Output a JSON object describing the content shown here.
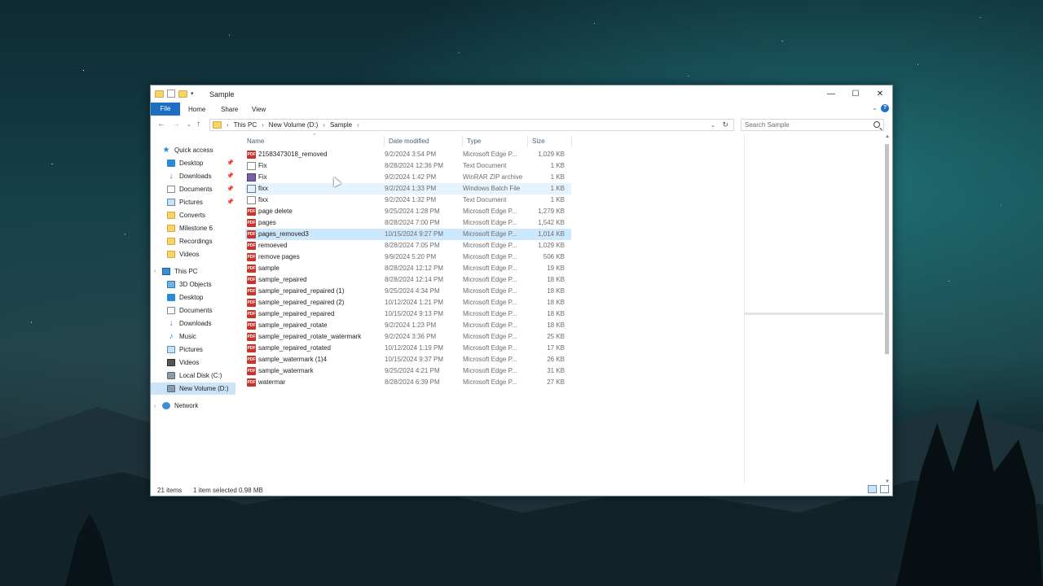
{
  "window": {
    "title": "Sample",
    "controls": {
      "minimize": "—",
      "maximize": "☐",
      "close": "✕"
    }
  },
  "ribbon": {
    "tabs": [
      {
        "label": "File",
        "active": true
      },
      {
        "label": "Home"
      },
      {
        "label": "Share"
      },
      {
        "label": "View"
      }
    ],
    "help_label": "?"
  },
  "address": {
    "breadcrumbs": [
      "This PC",
      "New Volume (D:)",
      "Sample"
    ],
    "search_placeholder": "Search Sample"
  },
  "sidebar": {
    "quick_access": {
      "label": "Quick access"
    },
    "quick_items": [
      {
        "label": "Desktop",
        "icon": "desktop-icon",
        "pinned": true
      },
      {
        "label": "Downloads",
        "icon": "download-icon",
        "pinned": true
      },
      {
        "label": "Documents",
        "icon": "documents-icon",
        "pinned": true
      },
      {
        "label": "Pictures",
        "icon": "pictures-icon",
        "pinned": true
      },
      {
        "label": "Converts",
        "icon": "folder-icon"
      },
      {
        "label": "Milestone 6",
        "icon": "folder-icon"
      },
      {
        "label": "Recordings",
        "icon": "folder-icon"
      },
      {
        "label": "Videos",
        "icon": "folder-icon"
      }
    ],
    "this_pc": {
      "label": "This PC"
    },
    "pc_items": [
      {
        "label": "3D Objects",
        "icon": "3d-objects-icon"
      },
      {
        "label": "Desktop",
        "icon": "desktop-icon"
      },
      {
        "label": "Documents",
        "icon": "documents-icon"
      },
      {
        "label": "Downloads",
        "icon": "download-icon"
      },
      {
        "label": "Music",
        "icon": "music-icon"
      },
      {
        "label": "Pictures",
        "icon": "pictures-icon"
      },
      {
        "label": "Videos",
        "icon": "videos-icon"
      },
      {
        "label": "Local Disk (C:)",
        "icon": "drive-icon"
      },
      {
        "label": "New Volume (D:)",
        "icon": "drive-icon",
        "selected": true
      }
    ],
    "network": {
      "label": "Network"
    }
  },
  "columns": {
    "name": "Name",
    "date": "Date modified",
    "type": "Type",
    "size": "Size"
  },
  "files": [
    {
      "name": "21583473018_removed",
      "date": "9/2/2024 3:54 PM",
      "type": "Microsoft Edge P...",
      "size": "1,029 KB",
      "icon": "pdf"
    },
    {
      "name": "Fix",
      "date": "8/28/2024 12:36 PM",
      "type": "Text Document",
      "size": "1 KB",
      "icon": "txt"
    },
    {
      "name": "Fix",
      "date": "9/2/2024 1:42 PM",
      "type": "WinRAR ZIP archive",
      "size": "1 KB",
      "icon": "zip"
    },
    {
      "name": "fixx",
      "date": "9/2/2024 1:33 PM",
      "type": "Windows Batch File",
      "size": "1 KB",
      "icon": "bat",
      "hover": true
    },
    {
      "name": "fixx",
      "date": "9/2/2024 1:32 PM",
      "type": "Text Document",
      "size": "1 KB",
      "icon": "txt"
    },
    {
      "name": "page delete",
      "date": "9/25/2024 1:28 PM",
      "type": "Microsoft Edge P...",
      "size": "1,279 KB",
      "icon": "pdf"
    },
    {
      "name": "pages",
      "date": "8/28/2024 7:00 PM",
      "type": "Microsoft Edge P...",
      "size": "1,542 KB",
      "icon": "pdf"
    },
    {
      "name": "pages_removed3",
      "date": "10/15/2024 9:27 PM",
      "type": "Microsoft Edge P...",
      "size": "1,014 KB",
      "icon": "pdf",
      "selected": true
    },
    {
      "name": "remoeved",
      "date": "8/28/2024 7:05 PM",
      "type": "Microsoft Edge P...",
      "size": "1,029 KB",
      "icon": "pdf"
    },
    {
      "name": "remove pages",
      "date": "9/9/2024 5:20 PM",
      "type": "Microsoft Edge P...",
      "size": "506 KB",
      "icon": "pdf"
    },
    {
      "name": "sample",
      "date": "8/28/2024 12:12 PM",
      "type": "Microsoft Edge P...",
      "size": "19 KB",
      "icon": "pdf"
    },
    {
      "name": "sample_repaired",
      "date": "8/28/2024 12:14 PM",
      "type": "Microsoft Edge P...",
      "size": "18 KB",
      "icon": "pdf"
    },
    {
      "name": "sample_repaired_repaired (1)",
      "date": "9/25/2024 4:34 PM",
      "type": "Microsoft Edge P...",
      "size": "18 KB",
      "icon": "pdf"
    },
    {
      "name": "sample_repaired_repaired (2)",
      "date": "10/12/2024 1:21 PM",
      "type": "Microsoft Edge P...",
      "size": "18 KB",
      "icon": "pdf"
    },
    {
      "name": "sample_repaired_repaired",
      "date": "10/15/2024 9:13 PM",
      "type": "Microsoft Edge P...",
      "size": "18 KB",
      "icon": "pdf"
    },
    {
      "name": "sample_repaired_rotate",
      "date": "9/2/2024 1:23 PM",
      "type": "Microsoft Edge P...",
      "size": "18 KB",
      "icon": "pdf"
    },
    {
      "name": "sample_repaired_rotate_watermark",
      "date": "9/2/2024 3:36 PM",
      "type": "Microsoft Edge P...",
      "size": "25 KB",
      "icon": "pdf"
    },
    {
      "name": "sample_repaired_rotated",
      "date": "10/12/2024 1:19 PM",
      "type": "Microsoft Edge P...",
      "size": "17 KB",
      "icon": "pdf"
    },
    {
      "name": "sample_watermark (1)4",
      "date": "10/15/2024 9:37 PM",
      "type": "Microsoft Edge P...",
      "size": "26 KB",
      "icon": "pdf"
    },
    {
      "name": "sample_watermark",
      "date": "9/25/2024 4:21 PM",
      "type": "Microsoft Edge P...",
      "size": "31 KB",
      "icon": "pdf"
    },
    {
      "name": "watermar",
      "date": "8/28/2024 6:39 PM",
      "type": "Microsoft Edge P...",
      "size": "27 KB",
      "icon": "pdf"
    }
  ],
  "status": {
    "items": "21 items",
    "selection": "1 item selected  0.98 MB"
  }
}
